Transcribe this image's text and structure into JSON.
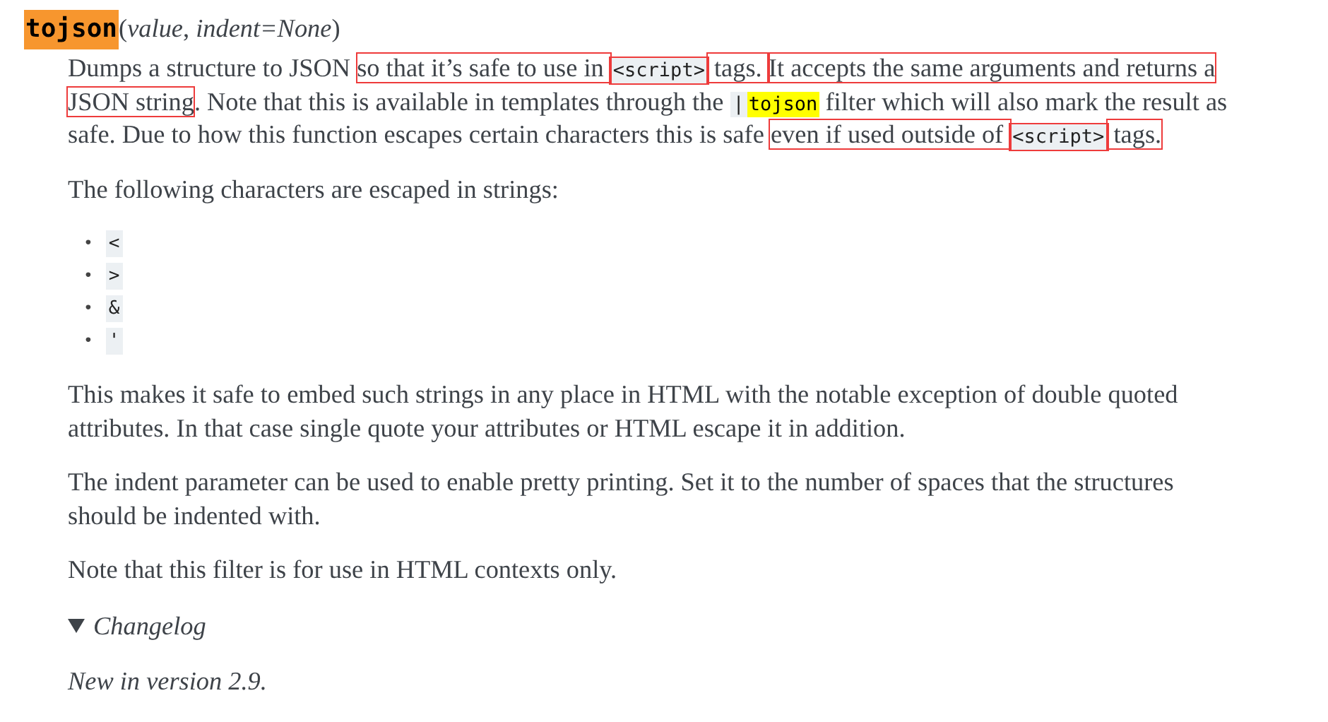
{
  "signature": {
    "name": "tojson",
    "highlighted": true,
    "arguments": "(*value*, *indent=None*)"
  },
  "paragraphs_before": [
    {
      "segments": [
        {
          "kind": "text",
          "text": "Dumps a structure to JSON ",
          "boxed": false
        },
        {
          "kind": "text",
          "text": "so that it’s safe to use in ",
          "boxed": true
        },
        {
          "kind": "code",
          "text": "<script>",
          "boxed": true
        },
        {
          "kind": "text",
          "text": " tags. ",
          "boxed": true
        },
        {
          "kind": "text",
          "text": "It accepts the same arguments and returns a JSON string",
          "boxed": true
        },
        {
          "kind": "text",
          "text": ". Note that this is available in templates through the ",
          "boxed": false
        },
        {
          "kind": "code",
          "text": "|",
          "boxed": false
        },
        {
          "kind": "highlight",
          "text": "tojson",
          "boxed": false
        },
        {
          "kind": "text",
          "text": " filter which will also mark the result as safe. Due to how this function escapes certain characters this is safe ",
          "boxed": false
        },
        {
          "kind": "text",
          "text": "even if used outside of ",
          "boxed": true
        },
        {
          "kind": "code",
          "text": "<script>",
          "boxed": true
        },
        {
          "kind": "text",
          "text": " tags.",
          "boxed": true
        }
      ]
    },
    {
      "segments": [
        {
          "kind": "text",
          "text": "The following characters are escaped in strings:",
          "boxed": false
        }
      ]
    }
  ],
  "escaped_characters": [
    {
      "bullet": "•",
      "text": "<"
    },
    {
      "bullet": "•",
      "text": ">"
    },
    {
      "bullet": "•",
      "text": "&"
    },
    {
      "bullet": "•",
      "text": "'"
    }
  ],
  "paragraphs_after": [
    "This makes it safe to embed such strings in any place in HTML with the notable exception of double quoted attributes. In that case single quote your attributes or HTML escape it in addition.",
    "The indent parameter can be used to enable pretty printing. Set it to the number of spaces that the structures should be indented with.",
    "Note that this filter is for use in HTML contexts only."
  ],
  "changelog": {
    "label": "Changelog",
    "expanded": true,
    "note": "New in version 2.9."
  }
}
